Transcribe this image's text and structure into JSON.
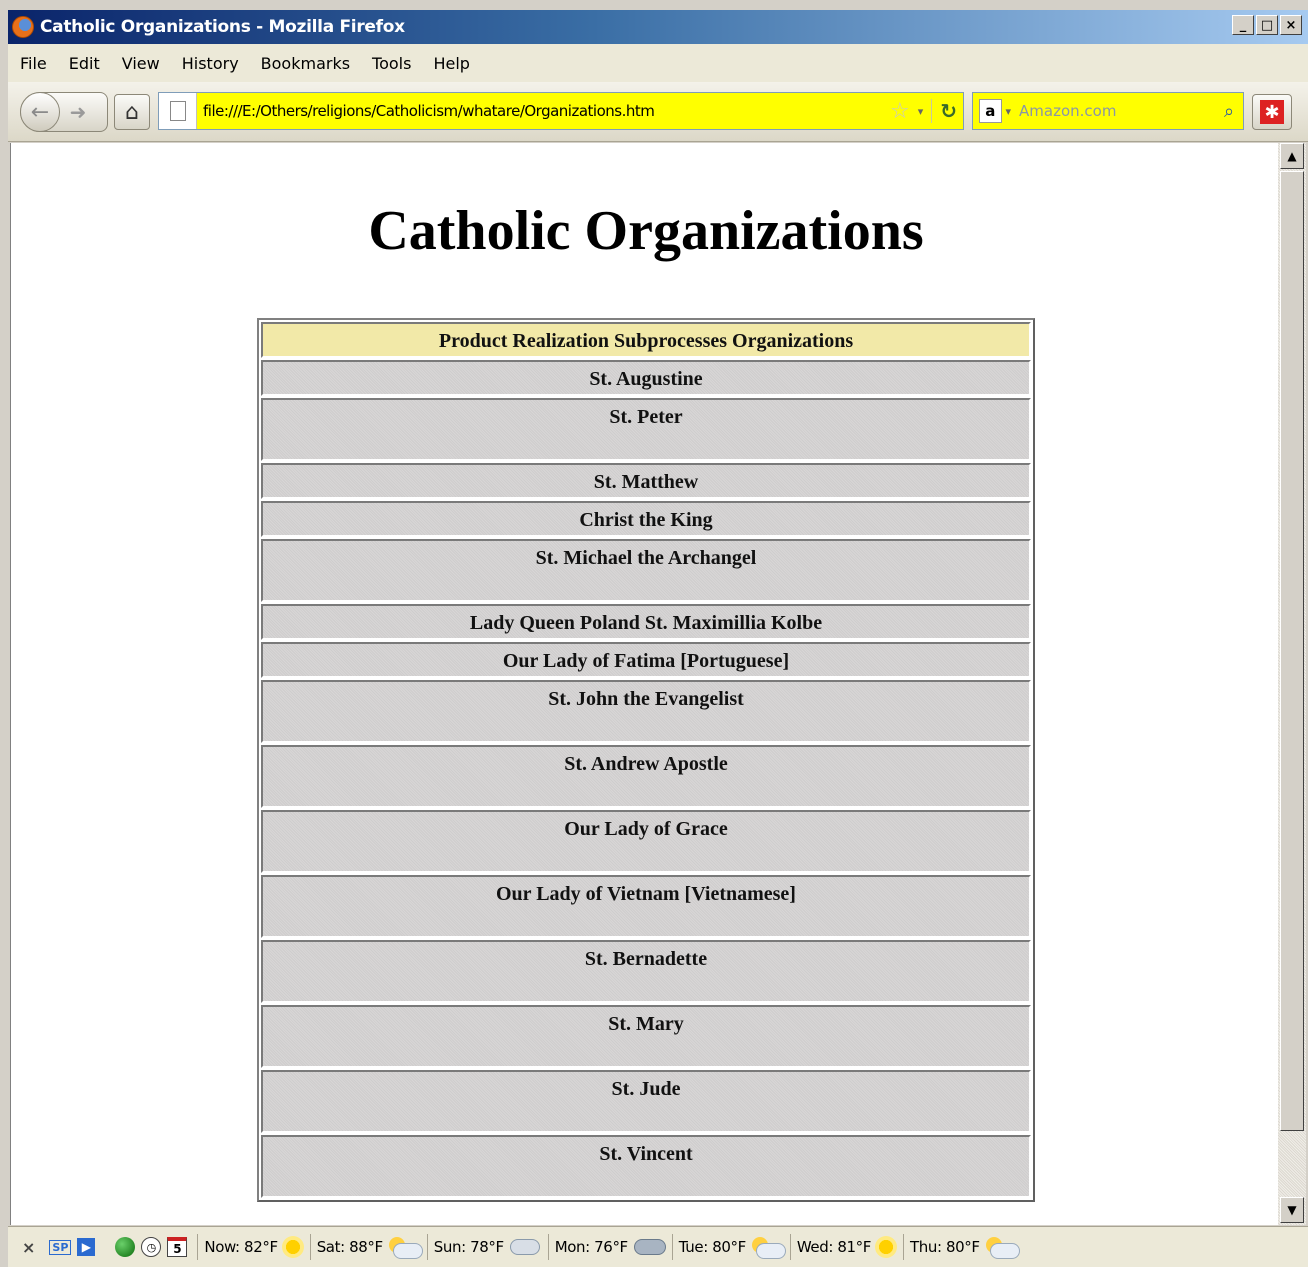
{
  "window": {
    "title": "Catholic Organizations - Mozilla Firefox",
    "minimize": "_",
    "maximize": "□",
    "close": "×"
  },
  "menu": [
    {
      "label": "File"
    },
    {
      "label": "Edit"
    },
    {
      "label": "View"
    },
    {
      "label": "History"
    },
    {
      "label": "Bookmarks"
    },
    {
      "label": "Tools"
    },
    {
      "label": "Help"
    }
  ],
  "navbar": {
    "url": "file:///E:/Others/religions/Catholicism/whatare/Organizations.htm",
    "search_placeholder": "Amazon.com",
    "search_engine_logo": "a",
    "icons": [
      "back-arrow",
      "forward-arrow",
      "home",
      "page",
      "bookmark-star",
      "dropdown",
      "reload",
      "search-magnifier",
      "addon"
    ]
  },
  "page": {
    "title": "Catholic Organizations",
    "table_header": "Product Realization Subprocesses Organizations",
    "header_color": "#f2e9a8",
    "rows": [
      {
        "label": "St. Augustine",
        "size": "short"
      },
      {
        "label": "St. Peter",
        "size": "tall"
      },
      {
        "label": "St. Matthew",
        "size": "short"
      },
      {
        "label": "Christ the King",
        "size": "short"
      },
      {
        "label": "St. Michael the Archangel",
        "size": "tall"
      },
      {
        "label": "Lady Queen Poland St. Maximillia Kolbe",
        "size": "short"
      },
      {
        "label": "Our Lady of Fatima [Portuguese]",
        "size": "short"
      },
      {
        "label": "St. John the Evangelist",
        "size": "tall"
      },
      {
        "label": "St. Andrew Apostle",
        "size": "tall"
      },
      {
        "label": "Our Lady of Grace",
        "size": "tall"
      },
      {
        "label": "Our Lady of Vietnam [Vietnamese]",
        "size": "tall"
      },
      {
        "label": "St. Bernadette",
        "size": "tall"
      },
      {
        "label": "St. Mary",
        "size": "tall"
      },
      {
        "label": "St. Jude",
        "size": "tall"
      },
      {
        "label": "St. Vincent",
        "size": "tall"
      }
    ]
  },
  "statusbar": {
    "close": "×",
    "sp": "SP",
    "calendar_day": "5",
    "forecast": [
      {
        "label": "Now: 82°F",
        "icon": "sun"
      },
      {
        "label": "Sat: 88°F",
        "icon": "partly-cloudy"
      },
      {
        "label": "Sun: 78°F",
        "icon": "thunderstorm"
      },
      {
        "label": "Mon: 76°F",
        "icon": "rain"
      },
      {
        "label": "Tue: 80°F",
        "icon": "partly-cloudy"
      },
      {
        "label": "Wed: 81°F",
        "icon": "sun"
      },
      {
        "label": "Thu: 80°F",
        "icon": "partly-cloudy"
      }
    ]
  }
}
